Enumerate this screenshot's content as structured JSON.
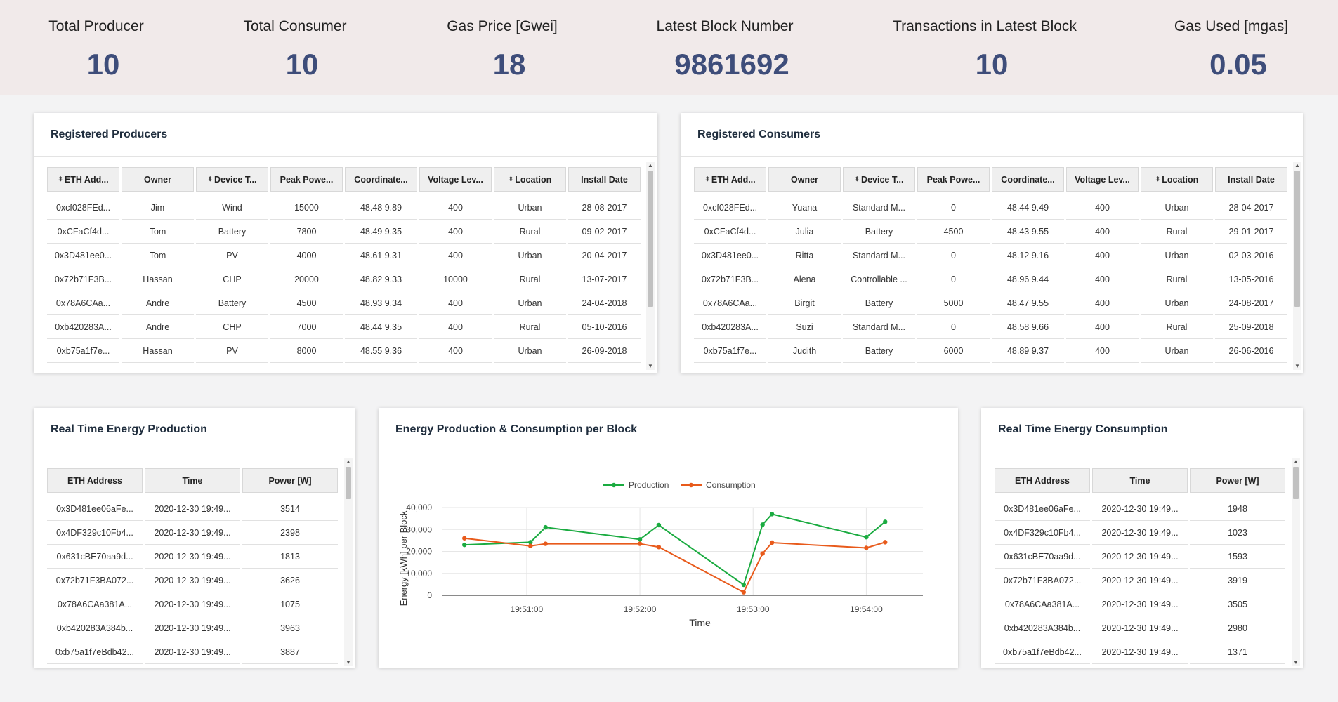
{
  "stats": [
    {
      "label": "Total Producer",
      "value": "10"
    },
    {
      "label": "Total Consumer",
      "value": "10"
    },
    {
      "label": "Gas Price [Gwei]",
      "value": "18"
    },
    {
      "label": "Latest Block Number",
      "value": "9861692"
    },
    {
      "label": "Transactions in Latest Block",
      "value": "10"
    },
    {
      "label": "Gas Used [mgas]",
      "value": "0.05"
    }
  ],
  "producers": {
    "title": "Registered Producers",
    "headers": [
      "ETH Add...",
      "Owner",
      "Device T...",
      "Peak Powe...",
      "Coordinate...",
      "Voltage Lev...",
      "Location",
      "Install Date"
    ],
    "rows": [
      [
        "0xcf028FEd...",
        "Jim",
        "Wind",
        "15000",
        "48.48 9.89",
        "400",
        "Urban",
        "28-08-2017"
      ],
      [
        "0xCFaCf4d...",
        "Tom",
        "Battery",
        "7800",
        "48.49 9.35",
        "400",
        "Rural",
        "09-02-2017"
      ],
      [
        "0x3D481ee0...",
        "Tom",
        "PV",
        "4000",
        "48.61 9.31",
        "400",
        "Urban",
        "20-04-2017"
      ],
      [
        "0x72b71F3B...",
        "Hassan",
        "CHP",
        "20000",
        "48.82 9.33",
        "10000",
        "Rural",
        "13-07-2017"
      ],
      [
        "0x78A6CAa...",
        "Andre",
        "Battery",
        "4500",
        "48.93 9.34",
        "400",
        "Urban",
        "24-04-2018"
      ],
      [
        "0xb420283A...",
        "Andre",
        "CHP",
        "7000",
        "48.44 9.35",
        "400",
        "Rural",
        "05-10-2016"
      ],
      [
        "0xb75a1f7e...",
        "Hassan",
        "PV",
        "8000",
        "48.55 9.36",
        "400",
        "Urban",
        "26-09-2018"
      ]
    ]
  },
  "consumers": {
    "title": "Registered Consumers",
    "headers": [
      "ETH Add...",
      "Owner",
      "Device T...",
      "Peak Powe...",
      "Coordinate...",
      "Voltage Lev...",
      "Location",
      "Install Date"
    ],
    "rows": [
      [
        "0xcf028FEd...",
        "Yuana",
        "Standard M...",
        "0",
        "48.44 9.49",
        "400",
        "Urban",
        "28-04-2017"
      ],
      [
        "0xCFaCf4d...",
        "Julia",
        "Battery",
        "4500",
        "48.43 9.55",
        "400",
        "Rural",
        "29-01-2017"
      ],
      [
        "0x3D481ee0...",
        "Ritta",
        "Standard M...",
        "0",
        "48.12 9.16",
        "400",
        "Urban",
        "02-03-2016"
      ],
      [
        "0x72b71F3B...",
        "Alena",
        "Controllable ...",
        "0",
        "48.96 9.44",
        "400",
        "Rural",
        "13-05-2016"
      ],
      [
        "0x78A6CAa...",
        "Birgit",
        "Battery",
        "5000",
        "48.47 9.55",
        "400",
        "Urban",
        "24-08-2017"
      ],
      [
        "0xb420283A...",
        "Suzi",
        "Standard M...",
        "0",
        "48.58 9.66",
        "400",
        "Rural",
        "25-09-2018"
      ],
      [
        "0xb75a1f7e...",
        "Judith",
        "Battery",
        "6000",
        "48.89 9.37",
        "400",
        "Urban",
        "26-06-2016"
      ]
    ]
  },
  "production": {
    "title": "Real Time Energy Production",
    "headers": [
      "ETH Address",
      "Time",
      "Power [W]"
    ],
    "rows": [
      [
        "0x3D481ee06aFe...",
        "2020-12-30 19:49...",
        "3514"
      ],
      [
        "0x4DF329c10Fb4...",
        "2020-12-30 19:49...",
        "2398"
      ],
      [
        "0x631cBE70aa9d...",
        "2020-12-30 19:49...",
        "1813"
      ],
      [
        "0x72b71F3BA072...",
        "2020-12-30 19:49...",
        "3626"
      ],
      [
        "0x78A6CAa381A...",
        "2020-12-30 19:49...",
        "1075"
      ],
      [
        "0xb420283A384b...",
        "2020-12-30 19:49...",
        "3963"
      ],
      [
        "0xb75a1f7eBdb42...",
        "2020-12-30 19:49...",
        "3887"
      ]
    ]
  },
  "consumption": {
    "title": "Real Time Energy Consumption",
    "headers": [
      "ETH Address",
      "Time",
      "Power [W]"
    ],
    "rows": [
      [
        "0x3D481ee06aFe...",
        "2020-12-30 19:49...",
        "1948"
      ],
      [
        "0x4DF329c10Fb4...",
        "2020-12-30 19:49...",
        "1023"
      ],
      [
        "0x631cBE70aa9d...",
        "2020-12-30 19:49...",
        "1593"
      ],
      [
        "0x72b71F3BA072...",
        "2020-12-30 19:49...",
        "3919"
      ],
      [
        "0x78A6CAa381A...",
        "2020-12-30 19:49...",
        "3505"
      ],
      [
        "0xb420283A384b...",
        "2020-12-30 19:49...",
        "2980"
      ],
      [
        "0xb75a1f7eBdb42...",
        "2020-12-30 19:49...",
        "1371"
      ]
    ]
  },
  "chart_panel": {
    "title": "Energy Production & Consumption per Block"
  },
  "chart_data": {
    "type": "line",
    "xlabel": "Time",
    "ylabel": "Energy [kWh] per Block",
    "x_ticks": [
      "19:51:00",
      "19:52:00",
      "19:53:00",
      "19:54:00"
    ],
    "y_ticks": [
      "0",
      "10,000",
      "20,000",
      "30,000",
      "40,000"
    ],
    "ylim": [
      0,
      40000
    ],
    "legend_position": "top-center",
    "x_unit": "seconds after 19:50:00",
    "series": [
      {
        "name": "Production",
        "color": "#1aab40",
        "x": [
          "19:50:27",
          "19:51:02",
          "19:51:10",
          "19:52:00",
          "19:52:10",
          "19:52:55",
          "19:53:05",
          "19:53:10",
          "19:54:00",
          "19:54:10"
        ],
        "y": [
          23000,
          24200,
          31000,
          25500,
          32000,
          4800,
          32200,
          37000,
          26500,
          33500
        ]
      },
      {
        "name": "Consumption",
        "color": "#e85a1b",
        "x": [
          "19:50:27",
          "19:51:02",
          "19:51:10",
          "19:52:00",
          "19:52:10",
          "19:52:55",
          "19:53:05",
          "19:53:10",
          "19:54:00",
          "19:54:10"
        ],
        "y": [
          26000,
          22500,
          23500,
          23500,
          22000,
          1400,
          19000,
          24000,
          21600,
          24200
        ]
      }
    ],
    "grid": true
  }
}
